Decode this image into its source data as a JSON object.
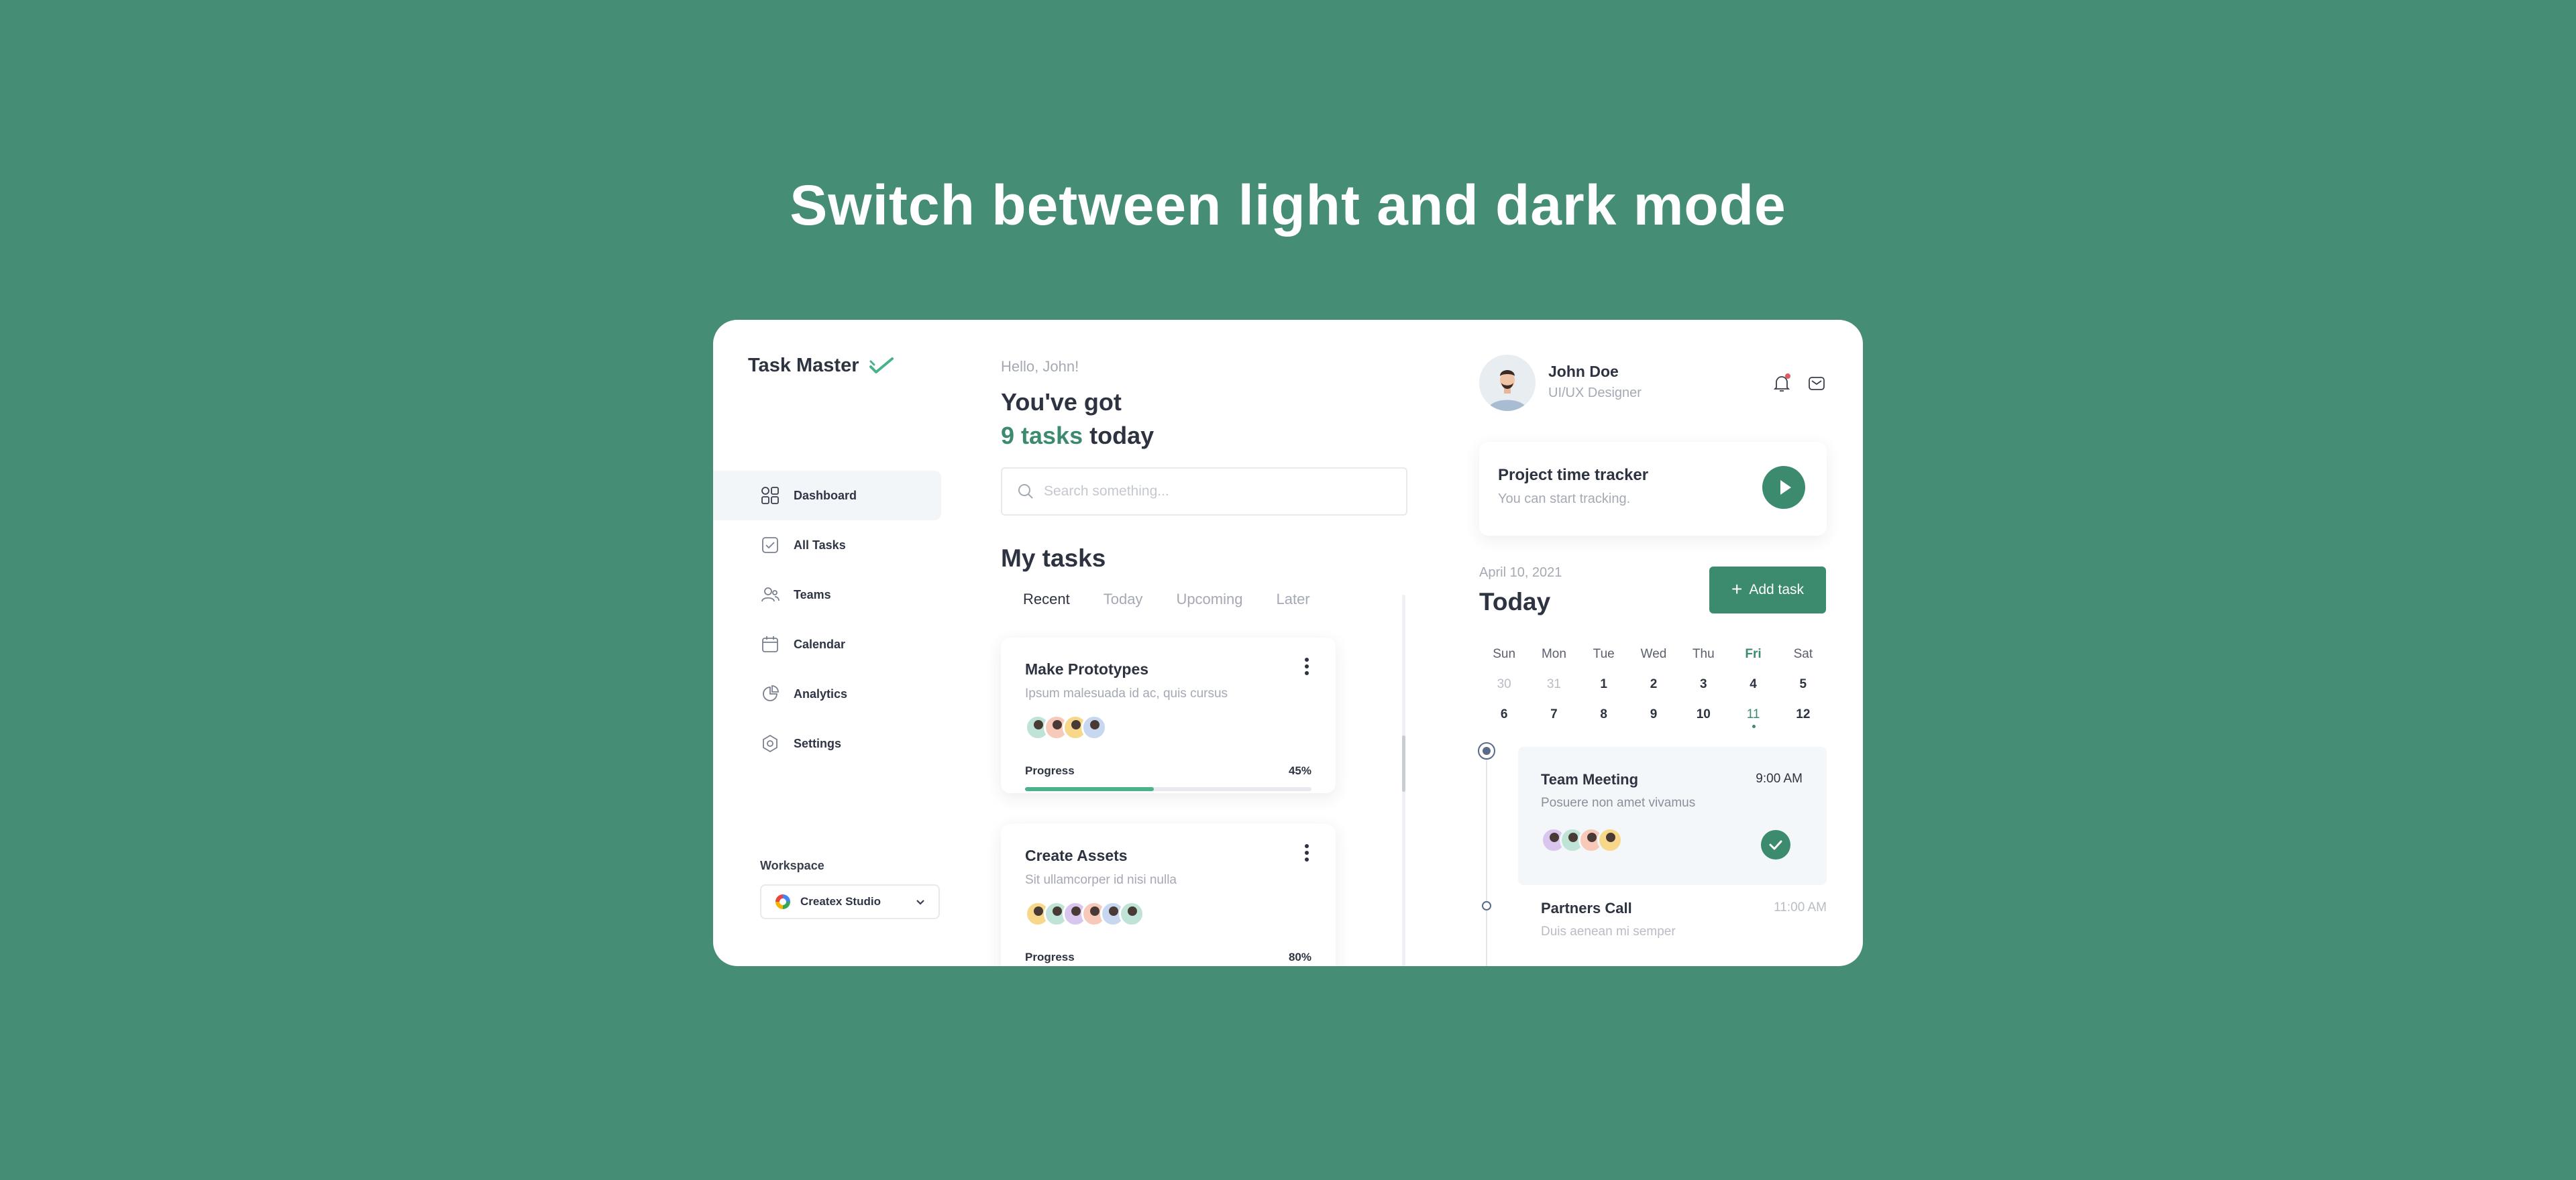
{
  "headline": "Switch between light and dark mode",
  "colors": {
    "background": "#468d75",
    "accent": "#3d8b6e",
    "progress": "#4ab288"
  },
  "sidebar": {
    "brand": "Task Master",
    "items": [
      {
        "label": "Dashboard",
        "icon": "dashboard-icon",
        "active": true
      },
      {
        "label": "All Tasks",
        "icon": "tasks-icon"
      },
      {
        "label": "Teams",
        "icon": "teams-icon"
      },
      {
        "label": "Calendar",
        "icon": "calendar-icon"
      },
      {
        "label": "Analytics",
        "icon": "analytics-icon"
      },
      {
        "label": "Settings",
        "icon": "settings-icon"
      }
    ],
    "workspace_label": "Workspace",
    "workspace_value": "Createx Studio"
  },
  "main": {
    "greeting": "Hello, John!",
    "heading_line1": "You've got",
    "heading_count": "9 tasks",
    "heading_suffix": "today",
    "search_placeholder": "Search something...",
    "my_tasks_title": "My tasks",
    "tabs": [
      "Recent",
      "Today",
      "Upcoming",
      "Later"
    ],
    "active_tab": "Recent",
    "tasks": [
      {
        "title": "Make Prototypes",
        "subtitle": "Ipsum malesuada id ac, quis cursus",
        "progress_label": "Progress",
        "progress_text": "45%",
        "progress": 0.45,
        "avatar_count": 4
      },
      {
        "title": "Create Assets",
        "subtitle": "Sit ullamcorper id nisi nulla",
        "progress_label": "Progress",
        "progress_text": "80%",
        "progress": 0.8,
        "avatar_count": 6
      }
    ]
  },
  "profile": {
    "name": "John Doe",
    "role": "UI/UX Designer"
  },
  "tracker": {
    "title": "Project time tracker",
    "subtitle": "You can start tracking."
  },
  "schedule": {
    "date": "April 10, 2021",
    "title": "Today",
    "add_task_label": "Add task",
    "calendar": {
      "weekdays": [
        "Sun",
        "Mon",
        "Tue",
        "Wed",
        "Thu",
        "Fri",
        "Sat"
      ],
      "highlight_weekday": "Fri",
      "week1": [
        "30",
        "31",
        "1",
        "2",
        "3",
        "4",
        "5"
      ],
      "week2": [
        "6",
        "7",
        "8",
        "9",
        "10",
        "11",
        "12"
      ],
      "selected_day": "11"
    },
    "events": [
      {
        "title": "Team Meeting",
        "subtitle": "Posuere non amet vivamus",
        "time": "9:00 AM"
      },
      {
        "title": "Partners Call",
        "subtitle": "Duis aenean mi semper",
        "time": "11:00 AM"
      }
    ]
  }
}
